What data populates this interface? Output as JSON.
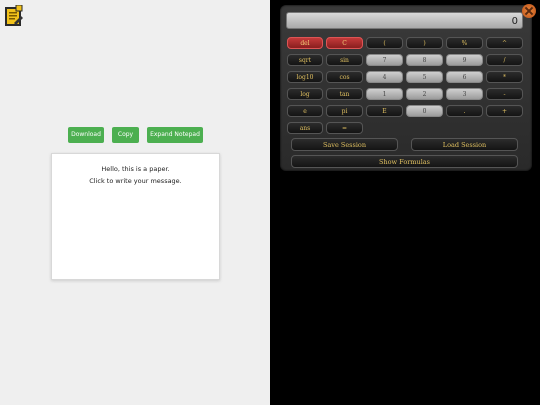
{
  "notepad": {
    "download_label": "Download",
    "copy_label": "Copy",
    "expand_label": "Expand Notepad",
    "paper_line1": "Hello, this is a paper.",
    "paper_line2": "Click to write your message."
  },
  "calculator": {
    "display": "0",
    "keys": {
      "del": "del",
      "c": "C",
      "lparen": "(",
      "rparen": ")",
      "pct": "%",
      "pow": "^",
      "sqrt": "sqrt",
      "sin": "sin",
      "d7": "7",
      "d8": "8",
      "d9": "9",
      "div": "/",
      "log10": "log10",
      "cos": "cos",
      "d4": "4",
      "d5": "5",
      "d6": "6",
      "mul": "*",
      "log": "log",
      "tan": "tan",
      "d1": "1",
      "d2": "2",
      "d3": "3",
      "sub": "-",
      "e": "e",
      "pi": "pi",
      "exp": "E",
      "d0": "0",
      "dot": ".",
      "add": "+",
      "ans": "ans",
      "eq": "="
    },
    "save_session": "Save Session",
    "load_session": "Load Session",
    "show_formulas": "Show Formulas"
  }
}
